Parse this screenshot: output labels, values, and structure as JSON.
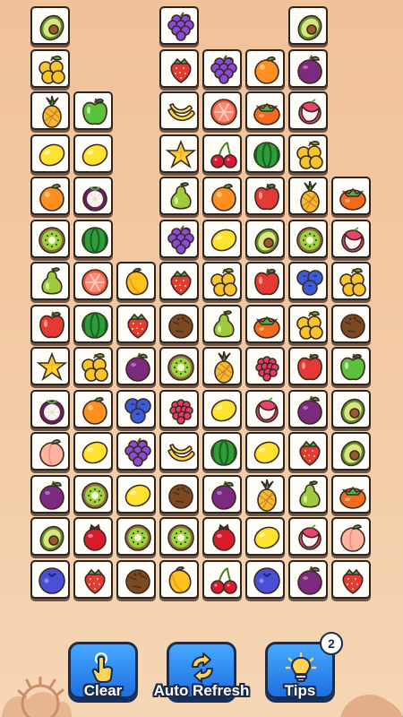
{
  "board": {
    "tiles": [
      {
        "col": 0,
        "row": 0,
        "fruit": "avocado"
      },
      {
        "col": 3,
        "row": 0,
        "fruit": "grapes"
      },
      {
        "col": 6,
        "row": 0,
        "fruit": "avocado"
      },
      {
        "col": 0,
        "row": 1,
        "fruit": "yellow-plum"
      },
      {
        "col": 3,
        "row": 1,
        "fruit": "strawberry"
      },
      {
        "col": 4,
        "row": 1,
        "fruit": "grapes"
      },
      {
        "col": 5,
        "row": 1,
        "fruit": "orange"
      },
      {
        "col": 6,
        "row": 1,
        "fruit": "plum"
      },
      {
        "col": 0,
        "row": 2,
        "fruit": "pineapple"
      },
      {
        "col": 1,
        "row": 2,
        "fruit": "green-apple"
      },
      {
        "col": 3,
        "row": 2,
        "fruit": "banana"
      },
      {
        "col": 4,
        "row": 2,
        "fruit": "grapefruit"
      },
      {
        "col": 5,
        "row": 2,
        "fruit": "persimmon"
      },
      {
        "col": 6,
        "row": 2,
        "fruit": "lychee"
      },
      {
        "col": 0,
        "row": 3,
        "fruit": "lemon"
      },
      {
        "col": 1,
        "row": 3,
        "fruit": "lemon"
      },
      {
        "col": 3,
        "row": 3,
        "fruit": "starfruit"
      },
      {
        "col": 4,
        "row": 3,
        "fruit": "cherries"
      },
      {
        "col": 5,
        "row": 3,
        "fruit": "watermelon"
      },
      {
        "col": 6,
        "row": 3,
        "fruit": "yellow-plum"
      },
      {
        "col": 0,
        "row": 4,
        "fruit": "orange"
      },
      {
        "col": 1,
        "row": 4,
        "fruit": "mangosteen"
      },
      {
        "col": 3,
        "row": 4,
        "fruit": "pear"
      },
      {
        "col": 4,
        "row": 4,
        "fruit": "orange"
      },
      {
        "col": 5,
        "row": 4,
        "fruit": "apple"
      },
      {
        "col": 6,
        "row": 4,
        "fruit": "pineapple"
      },
      {
        "col": 7,
        "row": 4,
        "fruit": "persimmon"
      },
      {
        "col": 0,
        "row": 5,
        "fruit": "kiwi"
      },
      {
        "col": 1,
        "row": 5,
        "fruit": "watermelon"
      },
      {
        "col": 3,
        "row": 5,
        "fruit": "grapes"
      },
      {
        "col": 4,
        "row": 5,
        "fruit": "lemon"
      },
      {
        "col": 5,
        "row": 5,
        "fruit": "avocado"
      },
      {
        "col": 6,
        "row": 5,
        "fruit": "kiwi"
      },
      {
        "col": 7,
        "row": 5,
        "fruit": "lychee"
      },
      {
        "col": 0,
        "row": 6,
        "fruit": "pear"
      },
      {
        "col": 1,
        "row": 6,
        "fruit": "grapefruit"
      },
      {
        "col": 2,
        "row": 6,
        "fruit": "mango"
      },
      {
        "col": 3,
        "row": 6,
        "fruit": "strawberry"
      },
      {
        "col": 4,
        "row": 6,
        "fruit": "yellow-plum"
      },
      {
        "col": 5,
        "row": 6,
        "fruit": "apple"
      },
      {
        "col": 6,
        "row": 6,
        "fruit": "blueberries"
      },
      {
        "col": 7,
        "row": 6,
        "fruit": "yellow-plum"
      },
      {
        "col": 0,
        "row": 7,
        "fruit": "apple"
      },
      {
        "col": 1,
        "row": 7,
        "fruit": "watermelon"
      },
      {
        "col": 2,
        "row": 7,
        "fruit": "strawberry"
      },
      {
        "col": 3,
        "row": 7,
        "fruit": "coconut"
      },
      {
        "col": 4,
        "row": 7,
        "fruit": "pear"
      },
      {
        "col": 5,
        "row": 7,
        "fruit": "persimmon"
      },
      {
        "col": 6,
        "row": 7,
        "fruit": "yellow-plum"
      },
      {
        "col": 7,
        "row": 7,
        "fruit": "coconut"
      },
      {
        "col": 0,
        "row": 8,
        "fruit": "starfruit"
      },
      {
        "col": 1,
        "row": 8,
        "fruit": "yellow-plum"
      },
      {
        "col": 2,
        "row": 8,
        "fruit": "plum"
      },
      {
        "col": 3,
        "row": 8,
        "fruit": "kiwi"
      },
      {
        "col": 4,
        "row": 8,
        "fruit": "pineapple"
      },
      {
        "col": 5,
        "row": 8,
        "fruit": "raspberry"
      },
      {
        "col": 6,
        "row": 8,
        "fruit": "apple"
      },
      {
        "col": 7,
        "row": 8,
        "fruit": "green-apple"
      },
      {
        "col": 0,
        "row": 9,
        "fruit": "mangosteen"
      },
      {
        "col": 1,
        "row": 9,
        "fruit": "orange"
      },
      {
        "col": 2,
        "row": 9,
        "fruit": "blueberries"
      },
      {
        "col": 3,
        "row": 9,
        "fruit": "raspberry"
      },
      {
        "col": 4,
        "row": 9,
        "fruit": "lemon"
      },
      {
        "col": 5,
        "row": 9,
        "fruit": "lychee"
      },
      {
        "col": 6,
        "row": 9,
        "fruit": "plum"
      },
      {
        "col": 7,
        "row": 9,
        "fruit": "avocado"
      },
      {
        "col": 0,
        "row": 10,
        "fruit": "peach"
      },
      {
        "col": 1,
        "row": 10,
        "fruit": "lemon"
      },
      {
        "col": 2,
        "row": 10,
        "fruit": "grapes"
      },
      {
        "col": 3,
        "row": 10,
        "fruit": "banana"
      },
      {
        "col": 4,
        "row": 10,
        "fruit": "watermelon"
      },
      {
        "col": 5,
        "row": 10,
        "fruit": "lemon"
      },
      {
        "col": 6,
        "row": 10,
        "fruit": "strawberry"
      },
      {
        "col": 7,
        "row": 10,
        "fruit": "avocado"
      },
      {
        "col": 0,
        "row": 11,
        "fruit": "plum"
      },
      {
        "col": 1,
        "row": 11,
        "fruit": "kiwi"
      },
      {
        "col": 2,
        "row": 11,
        "fruit": "lemon"
      },
      {
        "col": 3,
        "row": 11,
        "fruit": "coconut"
      },
      {
        "col": 4,
        "row": 11,
        "fruit": "plum"
      },
      {
        "col": 5,
        "row": 11,
        "fruit": "pineapple"
      },
      {
        "col": 6,
        "row": 11,
        "fruit": "pear"
      },
      {
        "col": 7,
        "row": 11,
        "fruit": "persimmon"
      },
      {
        "col": 0,
        "row": 12,
        "fruit": "avocado"
      },
      {
        "col": 1,
        "row": 12,
        "fruit": "pomegranate"
      },
      {
        "col": 2,
        "row": 12,
        "fruit": "kiwi"
      },
      {
        "col": 3,
        "row": 12,
        "fruit": "kiwi"
      },
      {
        "col": 4,
        "row": 12,
        "fruit": "pomegranate"
      },
      {
        "col": 5,
        "row": 12,
        "fruit": "lemon"
      },
      {
        "col": 6,
        "row": 12,
        "fruit": "lychee"
      },
      {
        "col": 7,
        "row": 12,
        "fruit": "peach"
      },
      {
        "col": 0,
        "row": 13,
        "fruit": "blueberry"
      },
      {
        "col": 1,
        "row": 13,
        "fruit": "strawberry"
      },
      {
        "col": 2,
        "row": 13,
        "fruit": "coconut"
      },
      {
        "col": 3,
        "row": 13,
        "fruit": "mango"
      },
      {
        "col": 4,
        "row": 13,
        "fruit": "cherries"
      },
      {
        "col": 5,
        "row": 13,
        "fruit": "blueberry"
      },
      {
        "col": 6,
        "row": 13,
        "fruit": "plum"
      },
      {
        "col": 7,
        "row": 13,
        "fruit": "strawberry"
      }
    ]
  },
  "toolbar": {
    "clear_label": "Clear",
    "clear_icon": "tap-hand-icon",
    "refresh_label": "Auto Refresh",
    "refresh_icon": "refresh-arrows-icon",
    "tips_label": "Tips",
    "tips_icon": "lightbulb-icon",
    "tips_count": "2"
  },
  "colors": {
    "background": "#f3cba6",
    "button": "#2f8cf0",
    "tile": "#fffdf8"
  }
}
